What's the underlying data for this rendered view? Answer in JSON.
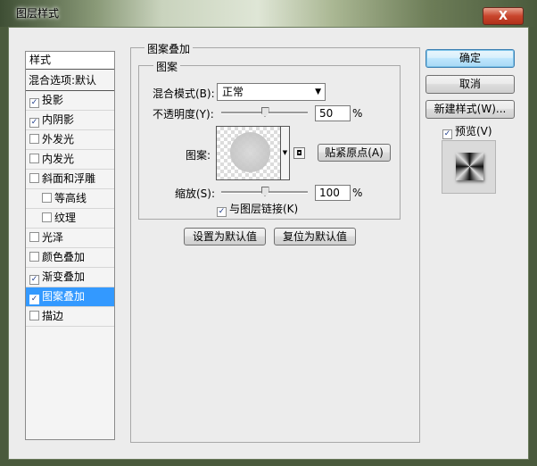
{
  "window": {
    "title": "图层样式",
    "close_label": "X"
  },
  "stylelist": {
    "header": "样式",
    "blend_options": "混合选项:默认",
    "items": [
      {
        "label": "投影",
        "checked": true,
        "sub": false,
        "selected": false
      },
      {
        "label": "内阴影",
        "checked": true,
        "sub": false,
        "selected": false
      },
      {
        "label": "外发光",
        "checked": false,
        "sub": false,
        "selected": false
      },
      {
        "label": "内发光",
        "checked": false,
        "sub": false,
        "selected": false
      },
      {
        "label": "斜面和浮雕",
        "checked": false,
        "sub": false,
        "selected": false
      },
      {
        "label": "等高线",
        "checked": false,
        "sub": true,
        "selected": false
      },
      {
        "label": "纹理",
        "checked": false,
        "sub": true,
        "selected": false
      },
      {
        "label": "光泽",
        "checked": false,
        "sub": false,
        "selected": false
      },
      {
        "label": "颜色叠加",
        "checked": false,
        "sub": false,
        "selected": false
      },
      {
        "label": "渐变叠加",
        "checked": true,
        "sub": false,
        "selected": false
      },
      {
        "label": "图案叠加",
        "checked": true,
        "sub": false,
        "selected": true
      },
      {
        "label": "描边",
        "checked": false,
        "sub": false,
        "selected": false
      }
    ]
  },
  "pattern_overlay": {
    "group_title": "图案叠加",
    "sub_title": "图案",
    "blend_mode_label": "混合模式(B):",
    "blend_mode_value": "正常",
    "opacity_label": "不透明度(Y):",
    "opacity_value": "50",
    "opacity_level": 0.5,
    "percent": "%",
    "pattern_label": "图案:",
    "snap_origin_button": "贴紧原点(A)",
    "scale_label": "缩放(S):",
    "scale_value": "100",
    "scale_level": 0.5,
    "link_label": "与图层链接(K)",
    "link_checked": true,
    "make_default_button": "设置为默认值",
    "reset_default_button": "复位为默认值"
  },
  "side_buttons": {
    "ok": "确定",
    "cancel": "取消",
    "new_style": "新建样式(W)...",
    "preview_label": "预览(V)",
    "preview_checked": true
  },
  "colors": {
    "selection": "#3399ff",
    "checkmark": "#1d3b8a"
  }
}
